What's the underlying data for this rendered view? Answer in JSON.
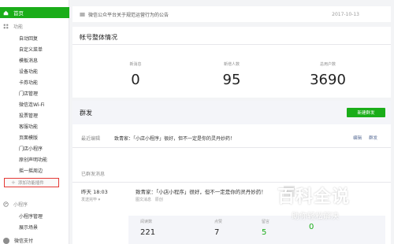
{
  "sidebar": {
    "home_label": "首页",
    "section_feature": "功能",
    "items": [
      "自动回复",
      "自定义菜单",
      "模板消息",
      "设备功能",
      "卡券功能",
      "门店管理",
      "微信连Wi-Fi",
      "投票管理",
      "客服功能",
      "页面模版",
      "门店小程序",
      "原创声明功能",
      "摇一摇周边"
    ],
    "add_plugin_label": "添加功能插件",
    "section_miniprogram": "小程序",
    "mini_items": [
      "小程序管理",
      "展示场景"
    ],
    "bottom_label": "微信支付"
  },
  "notice": {
    "text": "微信公众平台关于规范运营行为的公告",
    "date": "2017-10-13"
  },
  "overview": {
    "title": "帐号整体情况",
    "stats": [
      {
        "label": "新消息",
        "value": "0"
      },
      {
        "label": "新增人数",
        "value": "95"
      },
      {
        "label": "总用户数",
        "value": "3690"
      }
    ]
  },
  "mass": {
    "title": "群发",
    "new_button": "新建群发",
    "recent_label": "最近编辑",
    "recent_msg": "致青家：「小店小程序」很好，但不一定是你的灵丹妙药！",
    "edit_label": "编辑",
    "send_label": "群发",
    "sent_section": "已群发消息",
    "sent_time": "昨天 18:03",
    "sent_msg": "致青家：「小店小程序」很好，但不一定是你的灵丹妙药！",
    "sent_status": "发送完毕",
    "sent_type": "图文消息",
    "sent_tag": "原创",
    "metrics": [
      {
        "label": "阅读数",
        "value": "221",
        "color": "#222222"
      },
      {
        "label": "点赞",
        "value": "7",
        "color": "#222222"
      },
      {
        "label": "留言",
        "value": "5",
        "color": "#1aad19"
      },
      {
        "label": "",
        "value": "0",
        "color": "#1aad19"
      }
    ]
  },
  "watermark": {
    "logo": "百科全说",
    "sub": "助你轻松解决"
  },
  "colors": {
    "accent": "#1aad19",
    "highlight": "#e53935",
    "link": "#576b95"
  }
}
